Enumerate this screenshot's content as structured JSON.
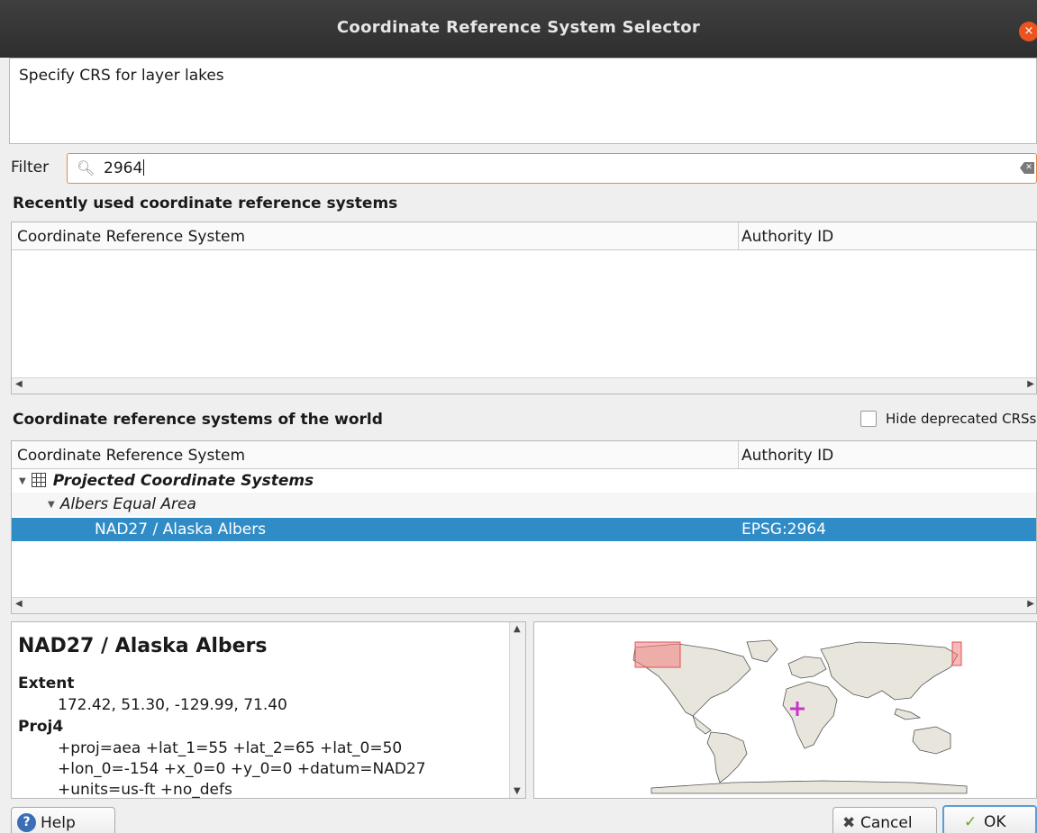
{
  "window": {
    "title": "Coordinate Reference System Selector",
    "close_glyph": "×"
  },
  "message": "Specify CRS for layer lakes",
  "filter": {
    "label": "Filter",
    "value": "2964",
    "search_icon": "search-icon",
    "clear_icon": "clear-icon"
  },
  "recent": {
    "title": "Recently used coordinate reference systems",
    "columns": [
      "Coordinate Reference System",
      "Authority ID"
    ]
  },
  "world": {
    "title": "Coordinate reference systems of the world",
    "hide_deprecated_label": "Hide deprecated CRSs",
    "hide_deprecated_checked": false,
    "columns": [
      "Coordinate Reference System",
      "Authority ID"
    ],
    "tree": {
      "group": "Projected Coordinate Systems",
      "subgroup": "Albers Equal Area",
      "selected": {
        "name": "NAD27 / Alaska Albers",
        "authority_id": "EPSG:2964"
      }
    }
  },
  "details": {
    "heading": "NAD27 / Alaska Albers",
    "extent_label": "Extent",
    "extent_value": "172.42, 51.30, -129.99, 71.40",
    "proj4_label": "Proj4",
    "proj4_lines": [
      "+proj=aea +lat_1=55 +lat_2=65 +lat_0=50",
      "+lon_0=-154 +x_0=0 +y_0=0 +datum=NAD27",
      "+units=us-ft +no_defs"
    ]
  },
  "buttons": {
    "help": "Help",
    "cancel": "Cancel",
    "ok": "OK"
  },
  "colors": {
    "selection": "#308cc6",
    "extent_highlight": "#f08080",
    "center_marker": "#cc33cc"
  }
}
